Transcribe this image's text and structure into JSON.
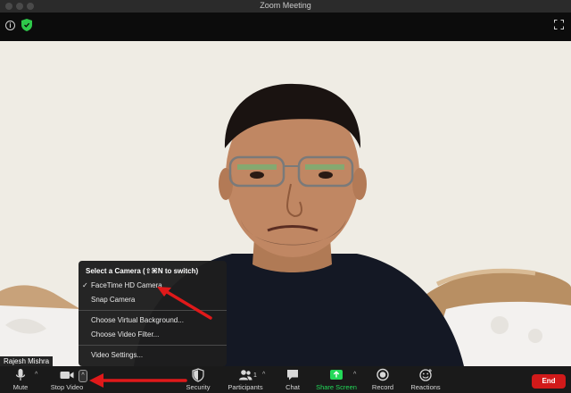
{
  "window": {
    "title": "Zoom Meeting"
  },
  "participant": {
    "name": "Rajesh Mishra"
  },
  "camera_menu": {
    "header": "Select a Camera (⇧⌘N to switch)",
    "cameras": [
      {
        "label": "FaceTime HD Camera",
        "selected": true
      },
      {
        "label": "Snap Camera",
        "selected": false
      }
    ],
    "options": [
      "Choose Virtual Background...",
      "Choose Video Filter..."
    ],
    "settings": "Video Settings..."
  },
  "toolbar": {
    "mute": "Mute",
    "stop_video": "Stop Video",
    "security": "Security",
    "participants": "Participants",
    "participant_count": "1",
    "chat": "Chat",
    "share_screen": "Share Screen",
    "record": "Record",
    "reactions": "Reactions",
    "end": "End"
  },
  "colors": {
    "share_green": "#23d959",
    "end_red": "#d11a1a",
    "annotation_red": "#e0191a",
    "security_shield_green": "#2ec84a"
  },
  "icons": [
    "info-icon",
    "shield-icon",
    "fullscreen-icon",
    "microphone-icon",
    "video-camera-icon",
    "security-shield-icon",
    "participants-icon",
    "chat-icon",
    "share-screen-icon",
    "record-icon",
    "reactions-icon",
    "chevron-up-icon",
    "checkmark-icon"
  ]
}
